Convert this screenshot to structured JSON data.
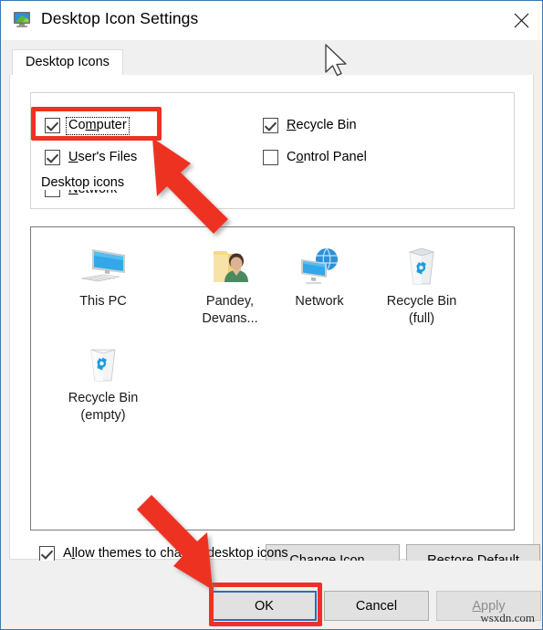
{
  "window": {
    "title": "Desktop Icon Settings",
    "icon": "desktop-monitor-icon",
    "close_label": "✕",
    "border_color": "#3b78b4"
  },
  "tabs": [
    {
      "label": "Desktop Icons",
      "selected": true
    }
  ],
  "group": {
    "title": "Desktop icons",
    "checkboxes": [
      {
        "label": "Computer",
        "accel": "m",
        "checked": true,
        "focused": true,
        "column": "left",
        "row": 0
      },
      {
        "label": "User's Files",
        "accel": "U",
        "checked": true,
        "focused": false,
        "column": "left",
        "row": 1
      },
      {
        "label": "Network",
        "accel": "N",
        "checked": false,
        "focused": false,
        "column": "left",
        "row": 2
      },
      {
        "label": "Recycle Bin",
        "accel": "R",
        "checked": true,
        "focused": false,
        "column": "right",
        "row": 0
      },
      {
        "label": "Control Panel",
        "accel": "o",
        "checked": false,
        "focused": false,
        "column": "right",
        "row": 1
      }
    ]
  },
  "preview": {
    "icons": [
      {
        "name": "this-pc-icon",
        "line1": "This PC",
        "line2": "",
        "art": "monitor"
      },
      {
        "name": "user-files-folder-icon",
        "line1": "Pandey,",
        "line2": "Devans...",
        "art": "userfolder"
      },
      {
        "name": "network-icon",
        "line1": "Network",
        "line2": "",
        "art": "network"
      },
      {
        "name": "recycle-bin-full-icon",
        "line1": "Recycle Bin",
        "line2": "(full)",
        "art": "bin-full"
      },
      {
        "name": "recycle-bin-empty-icon",
        "line1": "Recycle Bin",
        "line2": "(empty)",
        "art": "bin-empty"
      }
    ]
  },
  "buttons": {
    "change_icon": {
      "label": "Change Icon...",
      "accel": "h",
      "enabled": true
    },
    "restore_default": {
      "label": "Restore Default",
      "accel": "s",
      "enabled": true
    },
    "ok": {
      "label": "OK",
      "enabled": true,
      "focused": true
    },
    "cancel": {
      "label": "Cancel",
      "enabled": true
    },
    "apply": {
      "label": "Apply",
      "accel": "A",
      "enabled": false
    }
  },
  "allow_themes": {
    "label": "Allow themes to change desktop icons",
    "accel": "l",
    "checked": true
  },
  "annotations": {
    "highlight_color": "#ee3124",
    "focus_color": "#2a6fb5",
    "boxes": [
      {
        "name": "computer-checkbox-highlight"
      },
      {
        "name": "ok-button-highlight"
      }
    ],
    "arrows": [
      {
        "name": "arrow-to-computer-checkbox",
        "direction": "up-left"
      },
      {
        "name": "arrow-to-ok-button",
        "direction": "down-right"
      }
    ]
  },
  "watermark": {
    "text": "wsxdn.com"
  }
}
